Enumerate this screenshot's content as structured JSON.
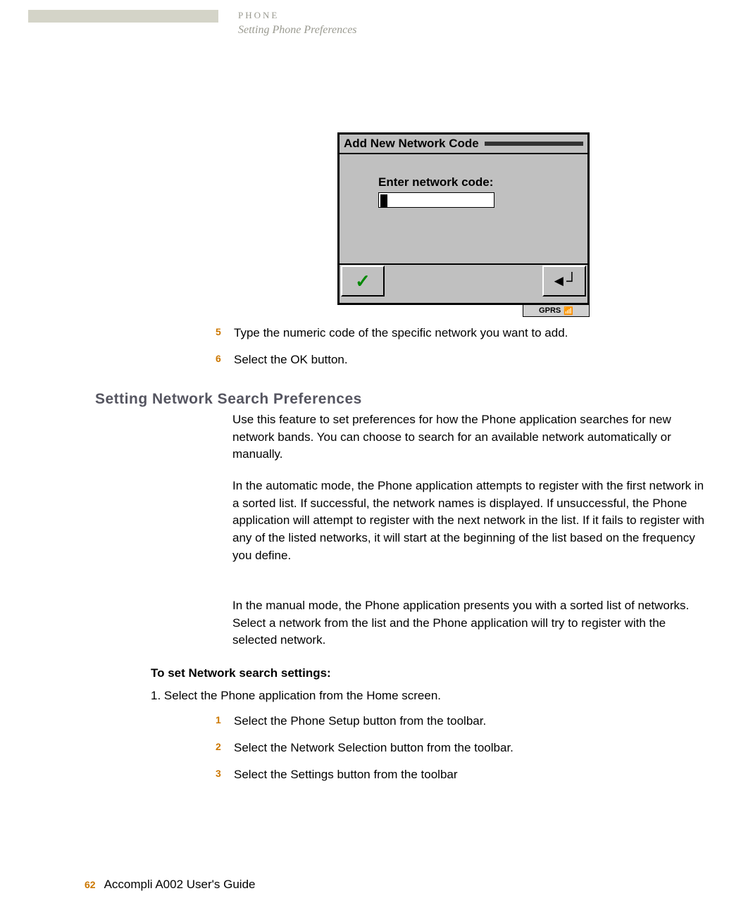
{
  "header": {
    "title": "PHONE",
    "subtitle": "Setting Phone Preferences"
  },
  "dialog": {
    "title": "Add New Network Code",
    "prompt": "Enter network code:",
    "input_value": "",
    "status_label": "GPRS"
  },
  "steps_top": [
    {
      "num": "5",
      "text": "Type the numeric code of the specific network you want to add."
    },
    {
      "num": "6",
      "text": "Select the OK button."
    }
  ],
  "section": {
    "heading": "Setting Network Search Preferences",
    "para1": "Use this feature to set preferences for how the Phone application searches for new network bands. You can choose to search for an available network automatically or manually.",
    "para2": "In the automatic mode, the Phone application attempts to register with the first network in a sorted list. If successful, the network names is displayed. If unsuccessful, the Phone application will attempt to register with the next network in the list.  If it fails to register with any of the listed networks, it will start at the beginning of the list based on the frequency you define.",
    "para3": "In the manual mode, the Phone application presents you with a sorted list of networks. Select a network from the list and the Phone application will try to register with the selected network."
  },
  "procedure": {
    "heading": "To set Network search settings:",
    "main_item": "1.   Select the Phone application from the Home screen.",
    "substeps": [
      {
        "num": "1",
        "text": "Select the Phone Setup button from the toolbar."
      },
      {
        "num": "2",
        "text": "Select the Network Selection button from the toolbar."
      },
      {
        "num": "3",
        "text": "Select the Settings button from the toolbar"
      }
    ]
  },
  "footer": {
    "page": "62",
    "guide": "Accompli A002 User's Guide"
  }
}
